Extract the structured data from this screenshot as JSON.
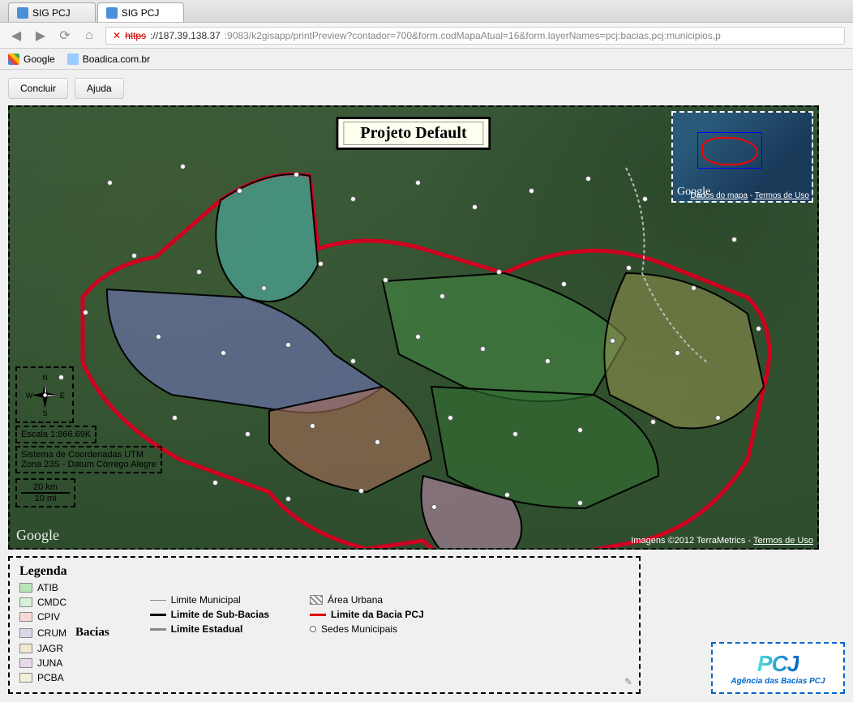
{
  "tabs": [
    {
      "title": "SIG PCJ",
      "active": false
    },
    {
      "title": "SIG PCJ",
      "active": true
    }
  ],
  "url": {
    "scheme": "https",
    "host": "://187.39.138.37",
    "path": ":9083/k2gisapp/printPreview?contador=700&form.codMapaAtual=16&form.layerNames=pcj:bacias,pcj:municipios,p"
  },
  "bookmarks": [
    {
      "label": "Google",
      "iconClass": "google-icon"
    },
    {
      "label": "Boadica.com.br",
      "iconClass": ""
    }
  ],
  "buttons": {
    "concluir": "Concluir",
    "ajuda": "Ajuda"
  },
  "map": {
    "title": "Projeto Default",
    "scale_text": "Escala 1:866.69K",
    "coord_line1": "Sistema de Coordenadas UTM",
    "coord_line2": "Zona 23S - Datum Córrego Alegre",
    "scalebar_km": "20 km",
    "scalebar_mi": "10 mi",
    "google_label": "Google",
    "attribution": "Imagens ©2012 TerraMetrics",
    "terms_link": "Termos de Uso",
    "minimap": {
      "google_label": "Google",
      "data_link": "Dados do mapa",
      "terms_link": "Termos de Uso"
    },
    "compass": {
      "n": "N",
      "s": "S",
      "e": "E",
      "w": "W"
    }
  },
  "legend": {
    "title": "Legenda",
    "subtitle": "Bacias",
    "basins": [
      {
        "code": "ATIB",
        "color": "#b8e8b8"
      },
      {
        "code": "CMDC",
        "color": "#d8f0d8"
      },
      {
        "code": "CPIV",
        "color": "#f8d8d8"
      },
      {
        "code": "CRUM",
        "color": "#d8d8e8"
      },
      {
        "code": "JAGR",
        "color": "#f0e8d0"
      },
      {
        "code": "JUNA",
        "color": "#e8d8e8"
      },
      {
        "code": "PCBA",
        "color": "#f0f0d8"
      }
    ],
    "lines": [
      {
        "label": "Limite Municipal",
        "color": "#888"
      },
      {
        "label": "Limite de Sub-Bacias",
        "color": "#000",
        "bold": true
      },
      {
        "label": "Limite Estadual",
        "color": "#888",
        "bold": true
      }
    ],
    "areas": [
      {
        "label": "Área Urbana",
        "type": "hatch"
      },
      {
        "label": "Limite da Bacia PCJ",
        "type": "line",
        "color": "#d00"
      },
      {
        "label": "Sedes Municipais",
        "type": "dot"
      }
    ]
  },
  "logo": {
    "main": "PCJ",
    "sub": "Agência das Bacias PCJ"
  },
  "dots": [
    [
      120,
      90
    ],
    [
      210,
      70
    ],
    [
      280,
      100
    ],
    [
      350,
      80
    ],
    [
      420,
      110
    ],
    [
      500,
      90
    ],
    [
      570,
      120
    ],
    [
      640,
      100
    ],
    [
      710,
      85
    ],
    [
      780,
      110
    ],
    [
      150,
      180
    ],
    [
      230,
      200
    ],
    [
      310,
      220
    ],
    [
      380,
      190
    ],
    [
      460,
      210
    ],
    [
      530,
      230
    ],
    [
      600,
      200
    ],
    [
      680,
      215
    ],
    [
      760,
      195
    ],
    [
      840,
      220
    ],
    [
      180,
      280
    ],
    [
      260,
      300
    ],
    [
      340,
      290
    ],
    [
      420,
      310
    ],
    [
      500,
      280
    ],
    [
      580,
      295
    ],
    [
      660,
      310
    ],
    [
      740,
      285
    ],
    [
      820,
      300
    ],
    [
      200,
      380
    ],
    [
      290,
      400
    ],
    [
      370,
      390
    ],
    [
      450,
      410
    ],
    [
      540,
      380
    ],
    [
      620,
      400
    ],
    [
      700,
      395
    ],
    [
      790,
      385
    ],
    [
      250,
      460
    ],
    [
      340,
      480
    ],
    [
      430,
      470
    ],
    [
      520,
      490
    ],
    [
      610,
      475
    ],
    [
      700,
      485
    ],
    [
      90,
      250
    ],
    [
      890,
      160
    ],
    [
      920,
      270
    ],
    [
      870,
      380
    ],
    [
      60,
      330
    ]
  ]
}
